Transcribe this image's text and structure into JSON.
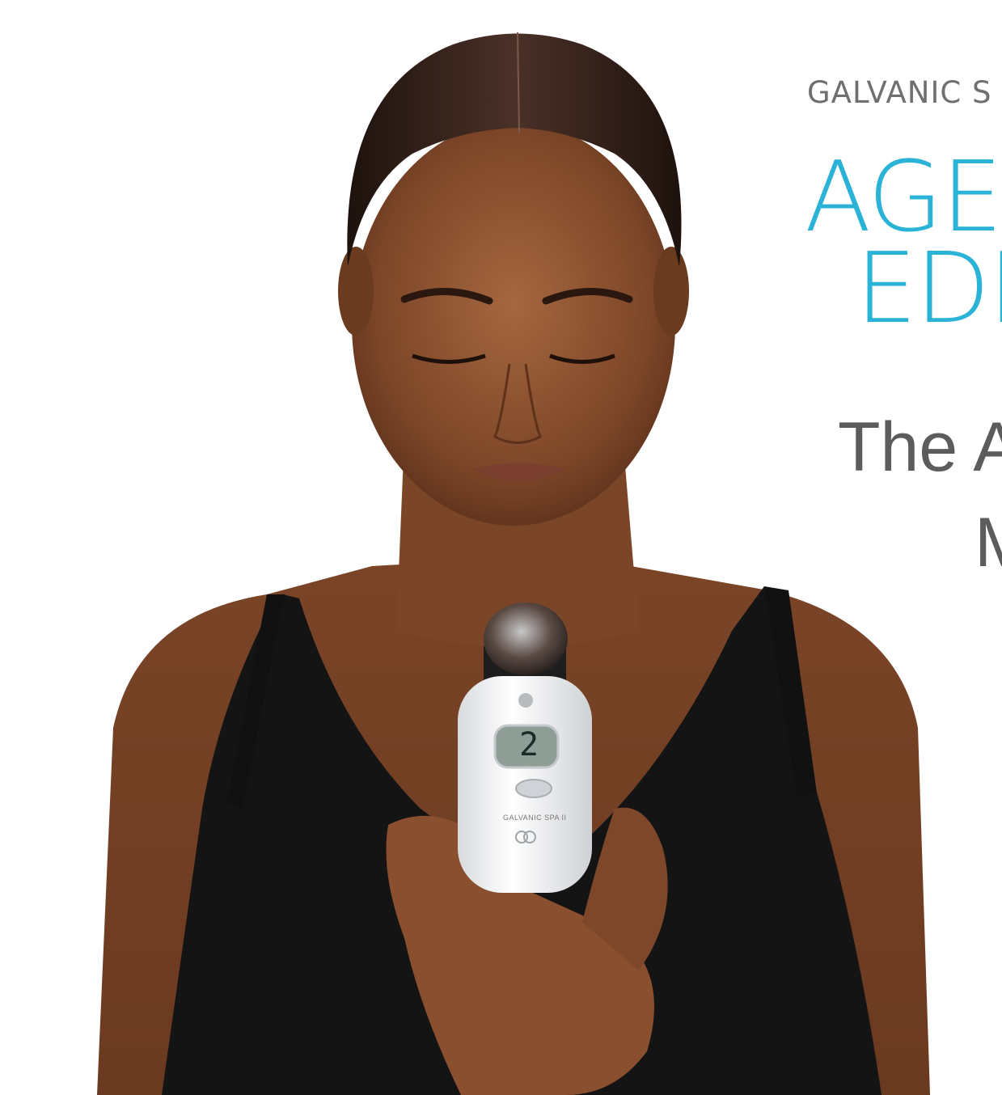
{
  "header": {
    "eyebrow": "GALVANIC S",
    "title_line1": "AGE",
    "title_line2": "EDI",
    "tagline_line1": "The A",
    "tagline_line2": "M"
  },
  "device": {
    "screen_value": "2",
    "brand_label": "GALVANIC SPA II"
  },
  "colors": {
    "accent": "#2ab3d6",
    "text_gray": "#5c5c5c",
    "background": "#ffffff"
  }
}
